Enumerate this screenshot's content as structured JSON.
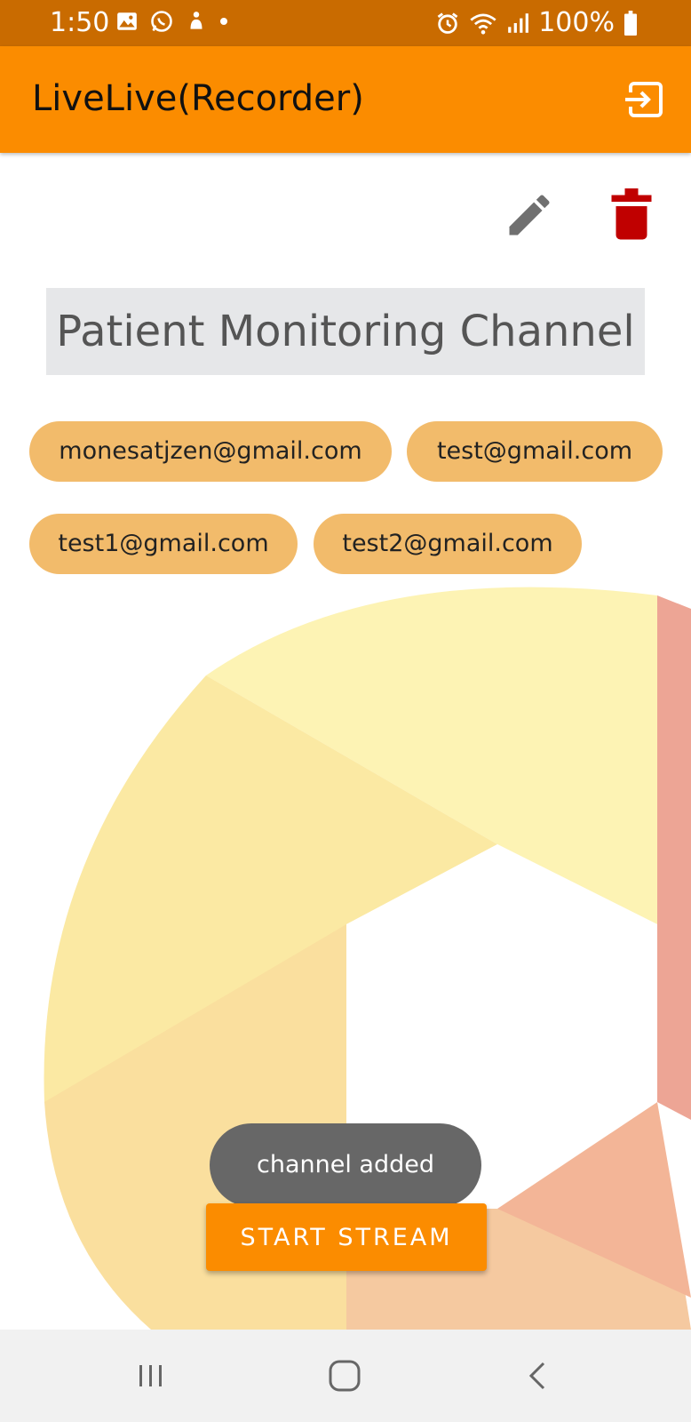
{
  "status_bar": {
    "time": "1:50",
    "battery": "100%",
    "icons": [
      "gallery-icon",
      "whatsapp-icon",
      "app-notification-icon",
      "dot-icon",
      "alarm-icon",
      "wifi-icon",
      "signal-icon",
      "battery-icon"
    ]
  },
  "app_bar": {
    "title": "LiveLive(Recorder)",
    "action_icon": "logout-icon"
  },
  "channel": {
    "name": "Patient Monitoring Channel",
    "edit_icon": "pencil-icon",
    "delete_icon": "trash-icon",
    "members": [
      "monesatjzen@gmail.com",
      "test@gmail.com",
      "test1@gmail.com",
      "test2@gmail.com"
    ]
  },
  "toast": {
    "message": "channel added"
  },
  "actions": {
    "start_stream_label": "START STREAM"
  },
  "nav_bar": {
    "icons": [
      "recents-icon",
      "home-icon",
      "back-icon"
    ]
  },
  "colors": {
    "status_bar": "#c96b00",
    "app_bar": "#fb8c00",
    "chip": "#f2bb6b",
    "delete": "#c00000",
    "toast": "#676767",
    "channel_name_bg": "#e6e7e9"
  }
}
